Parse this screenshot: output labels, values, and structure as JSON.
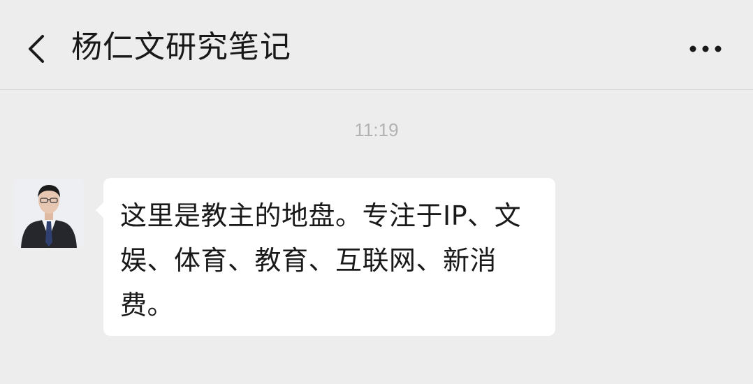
{
  "header": {
    "title": "杨仁文研究笔记",
    "back_icon": "chevron-left-icon",
    "more_icon": "more-horizontal-icon"
  },
  "conversation": {
    "timestamp": "11:19",
    "messages": [
      {
        "sender": "incoming",
        "text": "这里是教主的地盘。专注于IP、文娱、体育、教育、互联网、新消费。"
      }
    ]
  },
  "colors": {
    "background": "#ededed",
    "bubble": "#ffffff",
    "title_text": "#191919",
    "timestamp_text": "#b2b2b2"
  }
}
